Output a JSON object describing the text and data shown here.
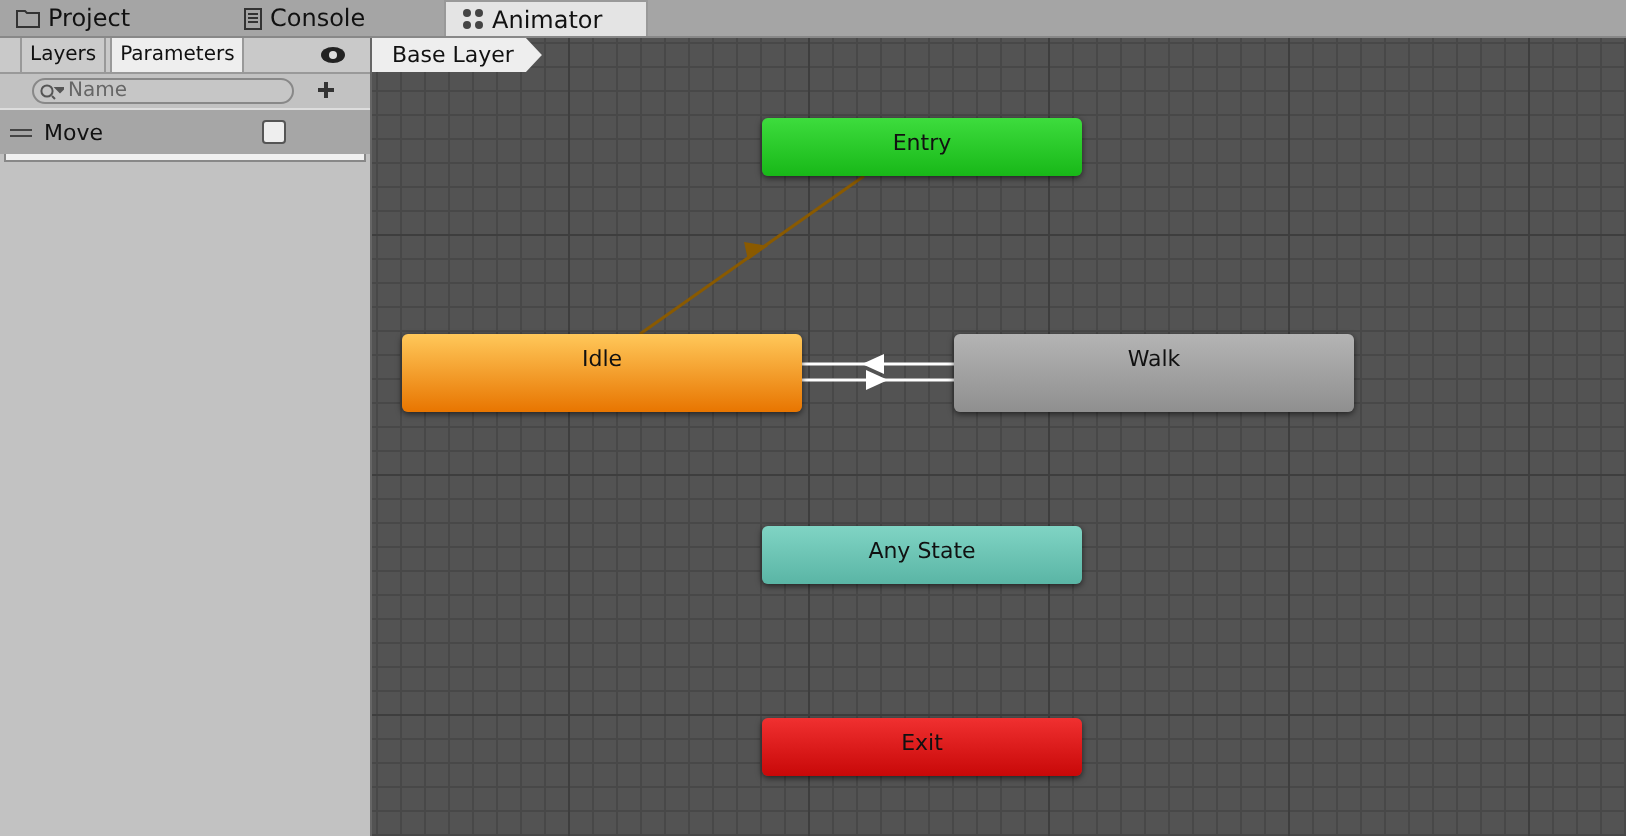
{
  "tabs": [
    {
      "label": "Project",
      "kind": "folder",
      "selected": false
    },
    {
      "label": "Console",
      "kind": "console",
      "selected": false
    },
    {
      "label": "Animator",
      "kind": "animator",
      "selected": true
    }
  ],
  "sidebar": {
    "tabs": [
      {
        "label": "Layers",
        "selected": false
      },
      {
        "label": "Parameters",
        "selected": true
      }
    ],
    "search": {
      "placeholder": "Name"
    },
    "parameters": [
      {
        "name": "Move",
        "kind": "bool",
        "checked": false
      }
    ]
  },
  "breadcrumb": "Base Layer",
  "nodes": [
    {
      "label": "Entry",
      "kind": "entry"
    },
    {
      "label": "Idle",
      "kind": "default"
    },
    {
      "label": "Walk",
      "kind": "state"
    },
    {
      "label": "Any State",
      "kind": "any"
    },
    {
      "label": "Exit",
      "kind": "exit"
    }
  ]
}
